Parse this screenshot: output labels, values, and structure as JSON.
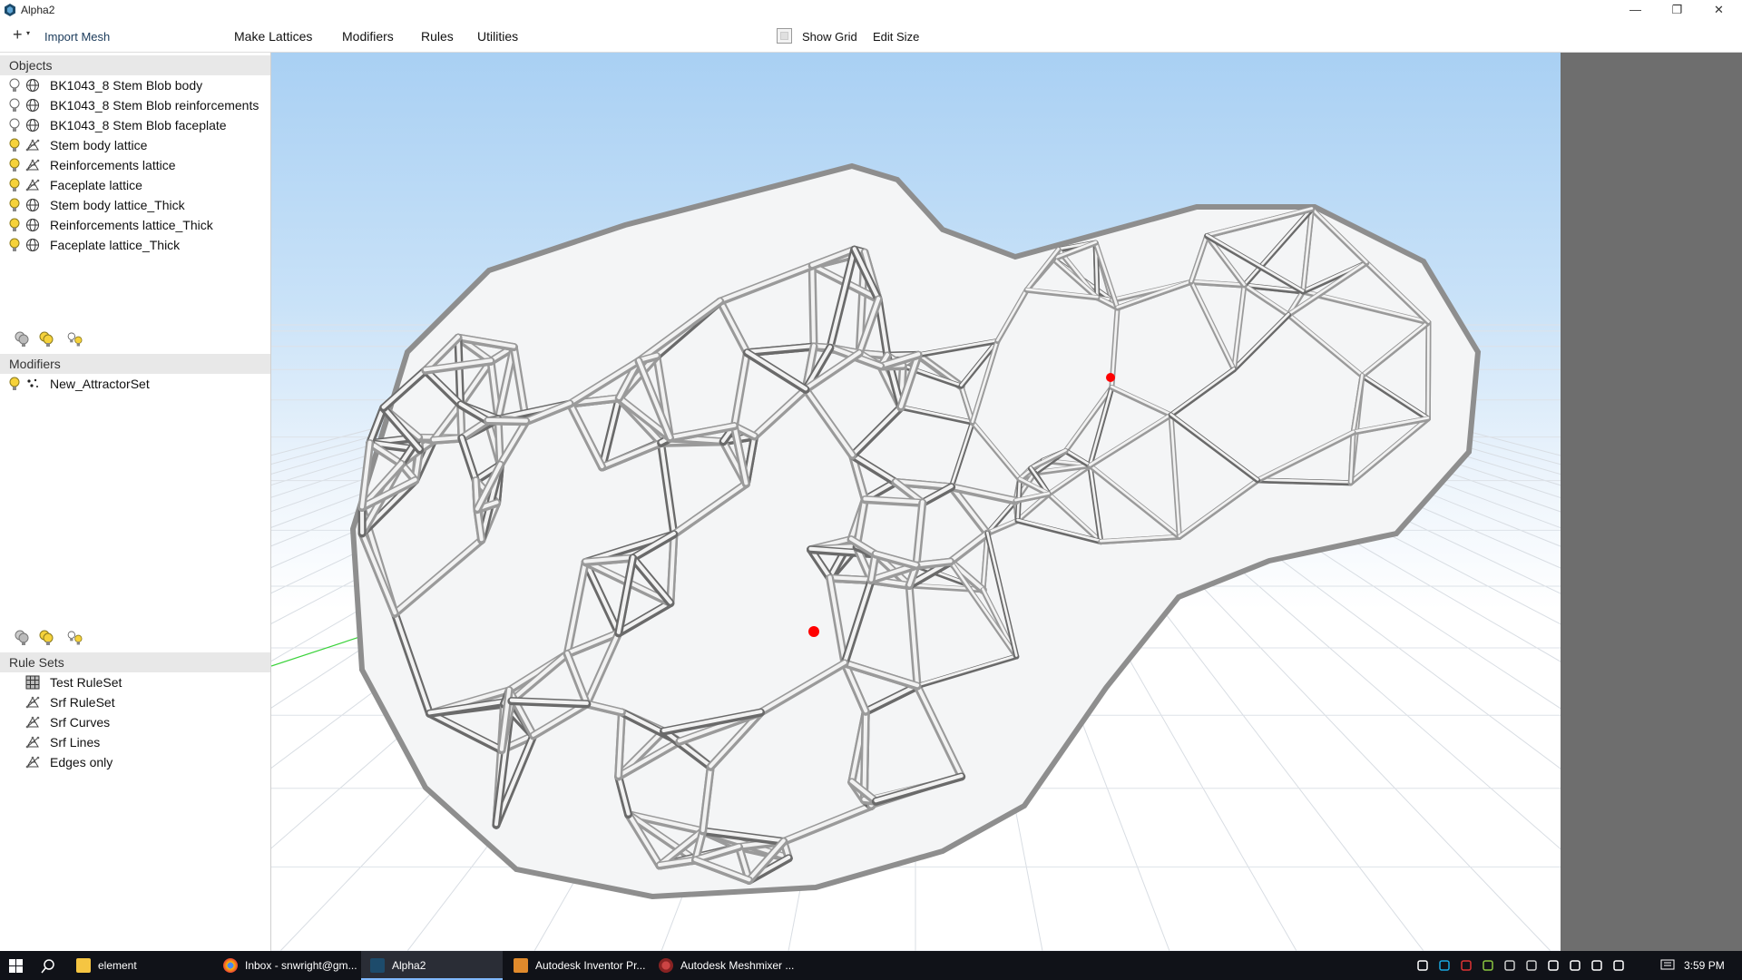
{
  "window": {
    "title": "Alpha2",
    "minimize": "—",
    "restore": "❐",
    "close": "✕"
  },
  "toolbar": {
    "import_label": "Import Mesh",
    "menus": [
      "Make Lattices",
      "Modifiers",
      "Rules",
      "Utilities"
    ],
    "show_grid_label": "Show Grid",
    "show_grid_checked": false,
    "edit_size_label": "Edit Size"
  },
  "objects": {
    "header": "Objects",
    "items": [
      {
        "label": "BK1043_8 Stem Blob body",
        "visible": false,
        "icon": "mesh-globe-icon"
      },
      {
        "label": "BK1043_8 Stem Blob reinforcements",
        "visible": false,
        "icon": "mesh-globe-icon"
      },
      {
        "label": "BK1043_8 Stem Blob faceplate",
        "visible": false,
        "icon": "mesh-globe-icon"
      },
      {
        "label": "Stem body lattice",
        "visible": true,
        "icon": "lattice-icon"
      },
      {
        "label": "Reinforcements lattice",
        "visible": true,
        "icon": "lattice-icon"
      },
      {
        "label": "Faceplate lattice",
        "visible": true,
        "icon": "lattice-icon"
      },
      {
        "label": "Stem body lattice_Thick",
        "visible": true,
        "icon": "mesh-globe-icon"
      },
      {
        "label": "Reinforcements lattice_Thick",
        "visible": true,
        "icon": "mesh-globe-icon"
      },
      {
        "label": "Faceplate lattice_Thick",
        "visible": true,
        "icon": "mesh-globe-icon"
      }
    ]
  },
  "modifiers": {
    "header": "Modifiers",
    "items": [
      {
        "label": "New_AttractorSet",
        "visible": true,
        "icon": "attractor-points-icon"
      }
    ]
  },
  "rulesets": {
    "header": "Rule Sets",
    "items": [
      {
        "label": "Test RuleSet",
        "icon": "grid-ruleset-icon"
      },
      {
        "label": "Srf RuleSet",
        "icon": "lattice-icon"
      },
      {
        "label": "Srf Curves",
        "icon": "lattice-icon"
      },
      {
        "label": "Srf Lines",
        "icon": "lattice-icon"
      },
      {
        "label": "Edges only",
        "icon": "lattice-icon"
      }
    ]
  },
  "taskbar": {
    "tasks": [
      "element",
      "Inbox - snwright@gm...",
      "Alpha2",
      "Autodesk Inventor Pr...",
      "Autodesk Meshmixer ..."
    ],
    "active_task": "Alpha2",
    "clock": "3:59 PM"
  },
  "colors": {
    "accent": "#7fb8ff",
    "sky_top": "#a9d0f3",
    "lattice": "#d8d8d8",
    "attractor_point": "#ff0000"
  }
}
